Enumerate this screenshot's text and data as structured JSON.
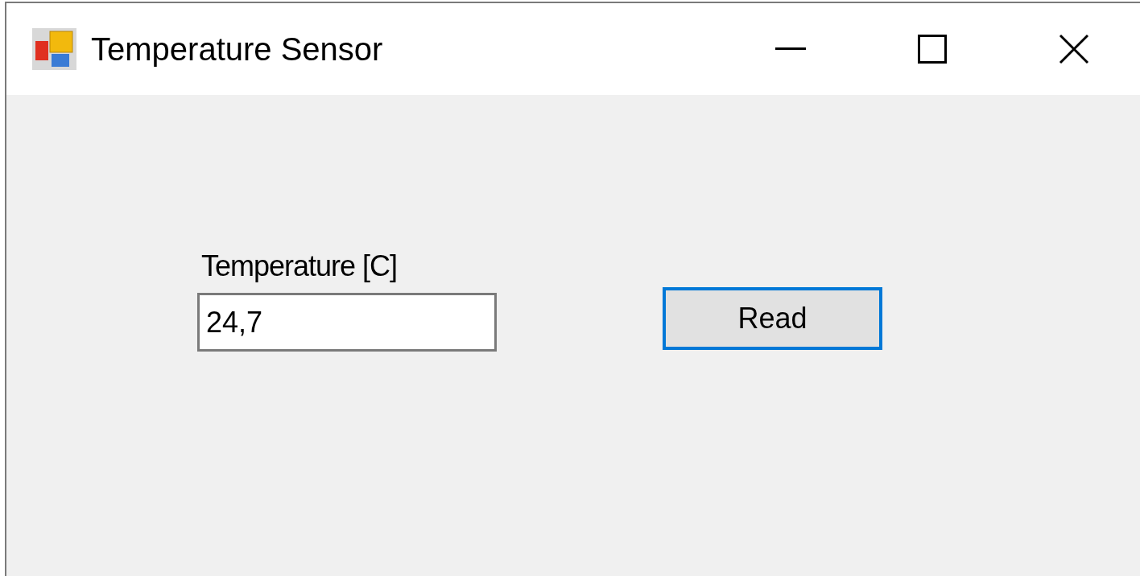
{
  "window": {
    "title": "Temperature Sensor"
  },
  "form": {
    "label": "Temperature [C]",
    "field": {
      "value": "24,7"
    },
    "button": {
      "label": "Read",
      "focused": true
    }
  }
}
